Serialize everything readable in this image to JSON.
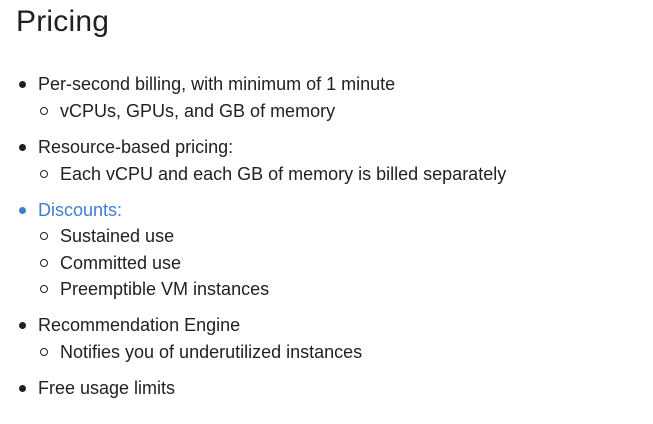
{
  "title": "Pricing",
  "colors": {
    "text": "#202124",
    "accent": "#3f7fd1"
  },
  "items": [
    {
      "text": "Per-second billing, with minimum of 1 minute"
    },
    {
      "text": "vCPUs, GPUs, and GB of memory"
    },
    {
      "text": "Resource-based pricing:"
    },
    {
      "text": "Each vCPU and each GB of memory is billed separately"
    },
    {
      "text": "Discounts:"
    },
    {
      "text": "Sustained use"
    },
    {
      "text": "Committed use"
    },
    {
      "text": "Preemptible VM instances"
    },
    {
      "text": "Recommendation Engine"
    },
    {
      "text": "Notifies you of underutilized instances"
    },
    {
      "text": "Free usage limits"
    }
  ]
}
